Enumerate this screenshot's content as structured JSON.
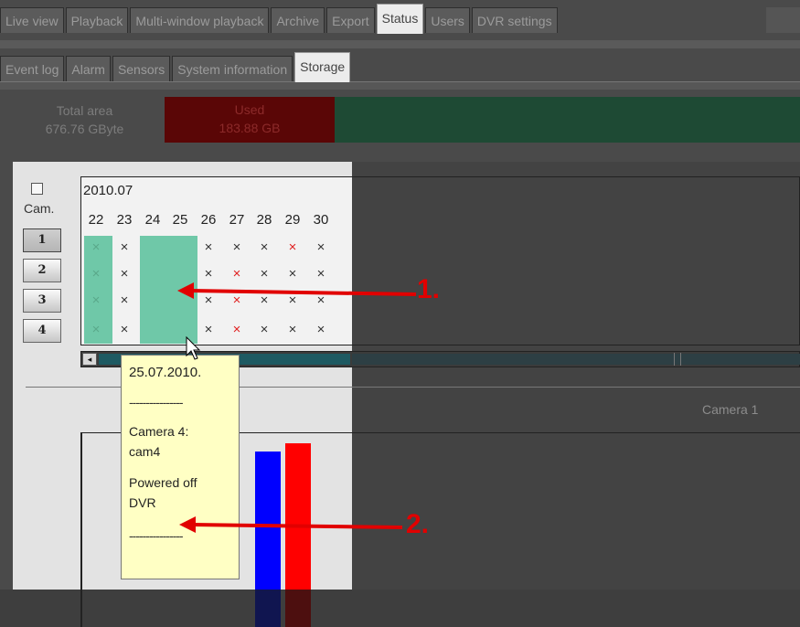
{
  "tabs": [
    {
      "label": "Live view",
      "active": false
    },
    {
      "label": "Playback",
      "active": false
    },
    {
      "label": "Multi-window playback",
      "active": false
    },
    {
      "label": "Archive",
      "active": false
    },
    {
      "label": "Export",
      "active": false
    },
    {
      "label": "Status",
      "active": true
    },
    {
      "label": "Users",
      "active": false
    },
    {
      "label": "DVR settings",
      "active": false
    }
  ],
  "subtabs": [
    {
      "label": "Event log",
      "active": false
    },
    {
      "label": "Alarm",
      "active": false
    },
    {
      "label": "Sensors",
      "active": false
    },
    {
      "label": "System information",
      "active": false
    },
    {
      "label": "Storage",
      "active": true
    }
  ],
  "storage": {
    "total_label": "Total area",
    "total_value": "676.76 GByte",
    "used_label": "Used",
    "used_value": "183.88 GB",
    "used_color": "#5a0606",
    "free_color": "#1e4a34"
  },
  "calendar": {
    "cam_label": "Cam.",
    "month": "2010.07",
    "days": [
      "22",
      "23",
      "24",
      "25",
      "26",
      "27",
      "28",
      "29",
      "30"
    ],
    "cameras": [
      "1",
      "2",
      "3",
      "4"
    ],
    "marks": [
      [
        "x",
        "x",
        "",
        "",
        "x",
        "x",
        "x",
        "xr",
        "x"
      ],
      [
        "x",
        "x",
        "",
        "",
        "x",
        "xr",
        "x",
        "x",
        "x"
      ],
      [
        "x",
        "x",
        "",
        "",
        "x",
        "xr",
        "x",
        "x",
        "x"
      ],
      [
        "x",
        "x",
        "",
        "",
        "x",
        "xr",
        "x",
        "x",
        "x"
      ]
    ],
    "mark_glyph": "×",
    "recorded_color": "#6fc8a8",
    "missing_color": "#e02020"
  },
  "tooltip": {
    "date": "25.07.2010.",
    "divider": "----------------",
    "camera_line1": "Camera 4:",
    "camera_line2": "cam4",
    "event_line1": "Powered off",
    "event_line2": "DVR"
  },
  "timeline": {
    "camera_label": "Camera 1",
    "bar_colors": [
      "#0000ff",
      "#ff0000"
    ]
  },
  "annotations": {
    "label1": "1.",
    "label2": "2.",
    "color": "#e10000"
  },
  "icons": {
    "scroll_left": "◂",
    "checkbox": "checkbox-icon",
    "cursor": "mouse-pointer-icon"
  }
}
